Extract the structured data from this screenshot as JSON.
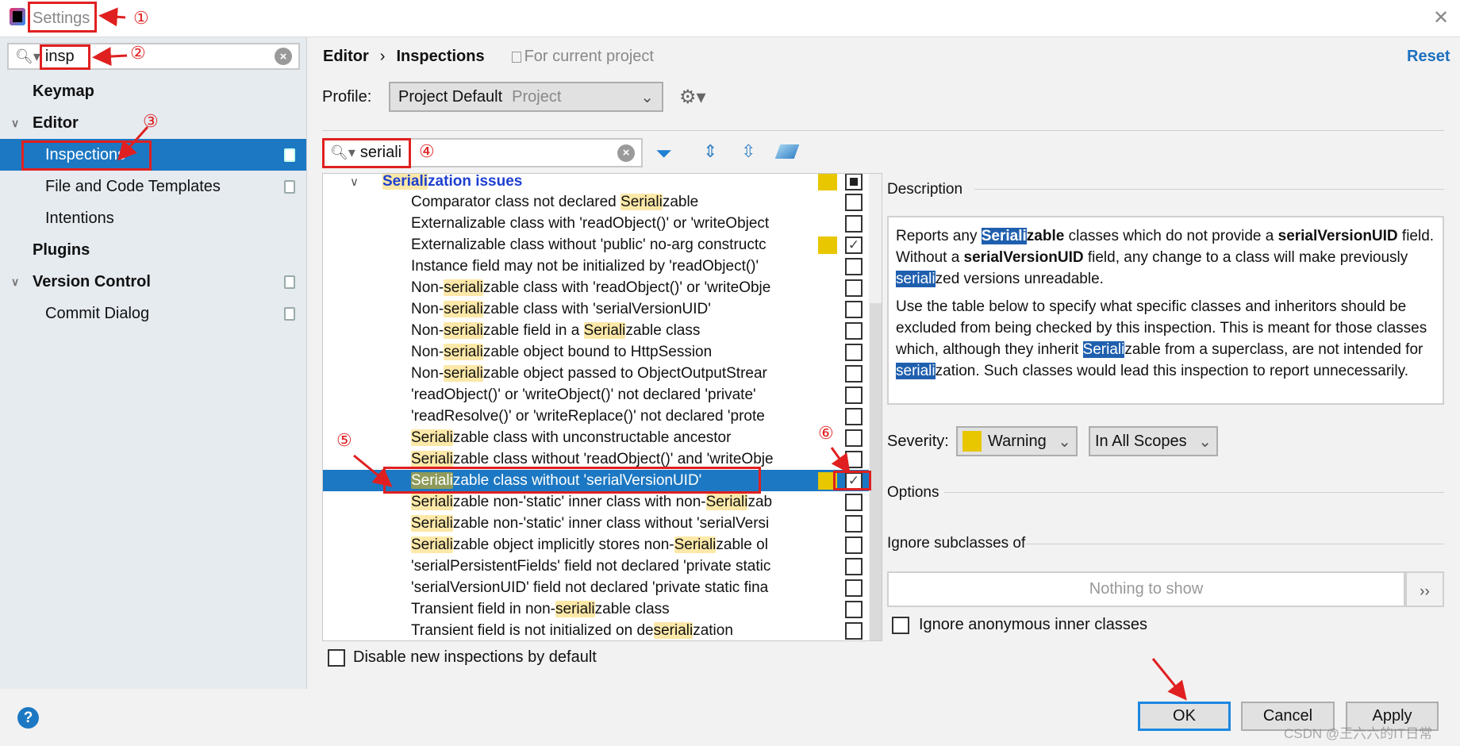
{
  "window": {
    "title": "Settings",
    "close_icon": "close-icon"
  },
  "sidebar": {
    "search_value": "insp",
    "items": [
      {
        "label": "Keymap",
        "bold": true,
        "level": 0
      },
      {
        "label": "Editor",
        "bold": true,
        "level": 0,
        "expanded": true
      },
      {
        "label": "Inspections",
        "level": 1,
        "selected": true,
        "project_icon": true
      },
      {
        "label": "File and Code Templates",
        "level": 1,
        "project_icon": true
      },
      {
        "label": "Intentions",
        "level": 1
      },
      {
        "label": "Plugins",
        "bold": true,
        "level": 0
      },
      {
        "label": "Version Control",
        "bold": true,
        "level": 0,
        "expanded": true,
        "project_icon": true
      },
      {
        "label": "Commit Dialog",
        "level": 1,
        "project_icon": true
      }
    ]
  },
  "header": {
    "crumb1": "Editor",
    "sep": "›",
    "crumb2": "Inspections",
    "scope": "For current project",
    "reset": "Reset"
  },
  "profile": {
    "label": "Profile:",
    "value": "Project Default",
    "suffix": "Project"
  },
  "filter": {
    "search_value": "seriali",
    "highlight": "seriali"
  },
  "tree": {
    "group": "Serialization issues",
    "group_state": "partial",
    "items": [
      {
        "text": "Comparator class not declared Serializable"
      },
      {
        "text": "Externalizable class with 'readObject()' or 'writeObject"
      },
      {
        "text": "Externalizable class without 'public' no-arg constructc",
        "checked": true,
        "severity": true
      },
      {
        "text": "Instance field may not be initialized by 'readObject()'"
      },
      {
        "text": "Non-serializable class with 'readObject()' or 'writeObje"
      },
      {
        "text": "Non-serializable class with 'serialVersionUID'"
      },
      {
        "text": "Non-serializable field in a Serializable class"
      },
      {
        "text": "Non-serializable object bound to HttpSession"
      },
      {
        "text": "Non-serializable object passed to ObjectOutputStrear"
      },
      {
        "text": "'readObject()' or 'writeObject()' not declared 'private'"
      },
      {
        "text": "'readResolve()' or 'writeReplace()' not declared 'prote"
      },
      {
        "text": "Serializable class with unconstructable ancestor"
      },
      {
        "text": "Serializable class without 'readObject()' and 'writeObje"
      },
      {
        "text": "Serializable class without 'serialVersionUID'",
        "checked": true,
        "severity": true,
        "selected": true
      },
      {
        "text": "Serializable non-'static' inner class with non-Serializab"
      },
      {
        "text": "Serializable non-'static' inner class without 'serialVersi"
      },
      {
        "text": "Serializable object implicitly stores non-Serializable ol"
      },
      {
        "text": "'serialPersistentFields' field not declared 'private static"
      },
      {
        "text": "'serialVersionUID' field not declared 'private static fina"
      },
      {
        "text": "Transient field in non-serializable class"
      },
      {
        "text": "Transient field is not initialized on deserialization"
      }
    ]
  },
  "disable_new": {
    "label": "Disable new inspections by default",
    "checked": false
  },
  "description": {
    "title": "Description",
    "paragraphs": [
      [
        {
          "t": "Reports any "
        },
        {
          "t": "Seriali",
          "b": 1,
          "hl": 1
        },
        {
          "t": "zable",
          "b": 1
        },
        {
          "t": " classes which do not provide a "
        },
        {
          "t": "serialVersionUID",
          "b": 1
        },
        {
          "t": " field. Without a "
        },
        {
          "t": "serialVersionUID",
          "b": 1
        },
        {
          "t": " field, any change to a class will make previously "
        },
        {
          "t": "seriali",
          "hl": 1
        },
        {
          "t": "zed versions unreadable."
        }
      ],
      [
        {
          "t": "Use the table below to specify what specific classes and inheritors should be excluded from being checked by this inspection. This is meant for those classes which, although they inherit "
        },
        {
          "t": "Seriali",
          "hl": 1
        },
        {
          "t": "zable from a superclass, are not intended for "
        },
        {
          "t": "seriali",
          "hl": 1
        },
        {
          "t": "zation. Such classes would lead this inspection to report unnecessarily."
        }
      ]
    ]
  },
  "severity": {
    "label": "Severity:",
    "value": "Warning",
    "color": "#e8c600",
    "scope": "In All Scopes"
  },
  "options": {
    "title": "Options",
    "ignore_title": "Ignore subclasses of",
    "empty": "Nothing to show",
    "more": "››",
    "anon_label": "Ignore anonymous inner classes",
    "anon_checked": false
  },
  "buttons": {
    "ok": "OK",
    "cancel": "Cancel",
    "apply": "Apply",
    "help": "?"
  },
  "annotations": [
    "①",
    "②",
    "③",
    "④",
    "⑤",
    "⑥"
  ],
  "watermark": "CSDN @王六六的IT日常",
  "colors": {
    "accent": "#1c78c3",
    "annotation": "#e02020",
    "highlight": "#fce8a8"
  }
}
